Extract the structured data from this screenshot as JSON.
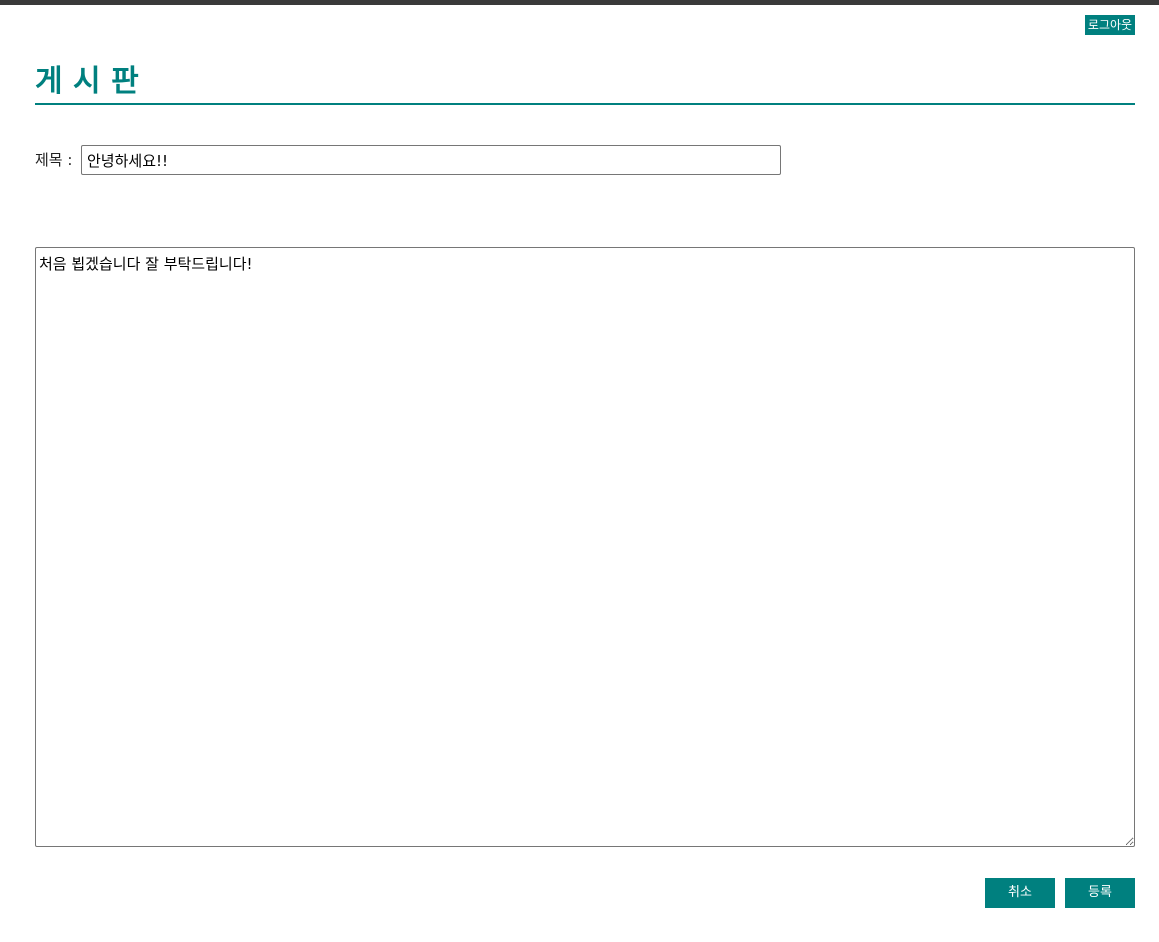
{
  "header": {
    "logout_label": "로그아웃"
  },
  "page": {
    "title": "게 시 판"
  },
  "form": {
    "subject_label": "제목 :",
    "subject_value": "안녕하세요!!",
    "content_value": "처음 뵙겠습니다 잘 부탁드립니다!"
  },
  "actions": {
    "cancel_label": "취소",
    "submit_label": "등록"
  },
  "colors": {
    "accent": "#00807f",
    "top_border": "#3a3a3a"
  }
}
